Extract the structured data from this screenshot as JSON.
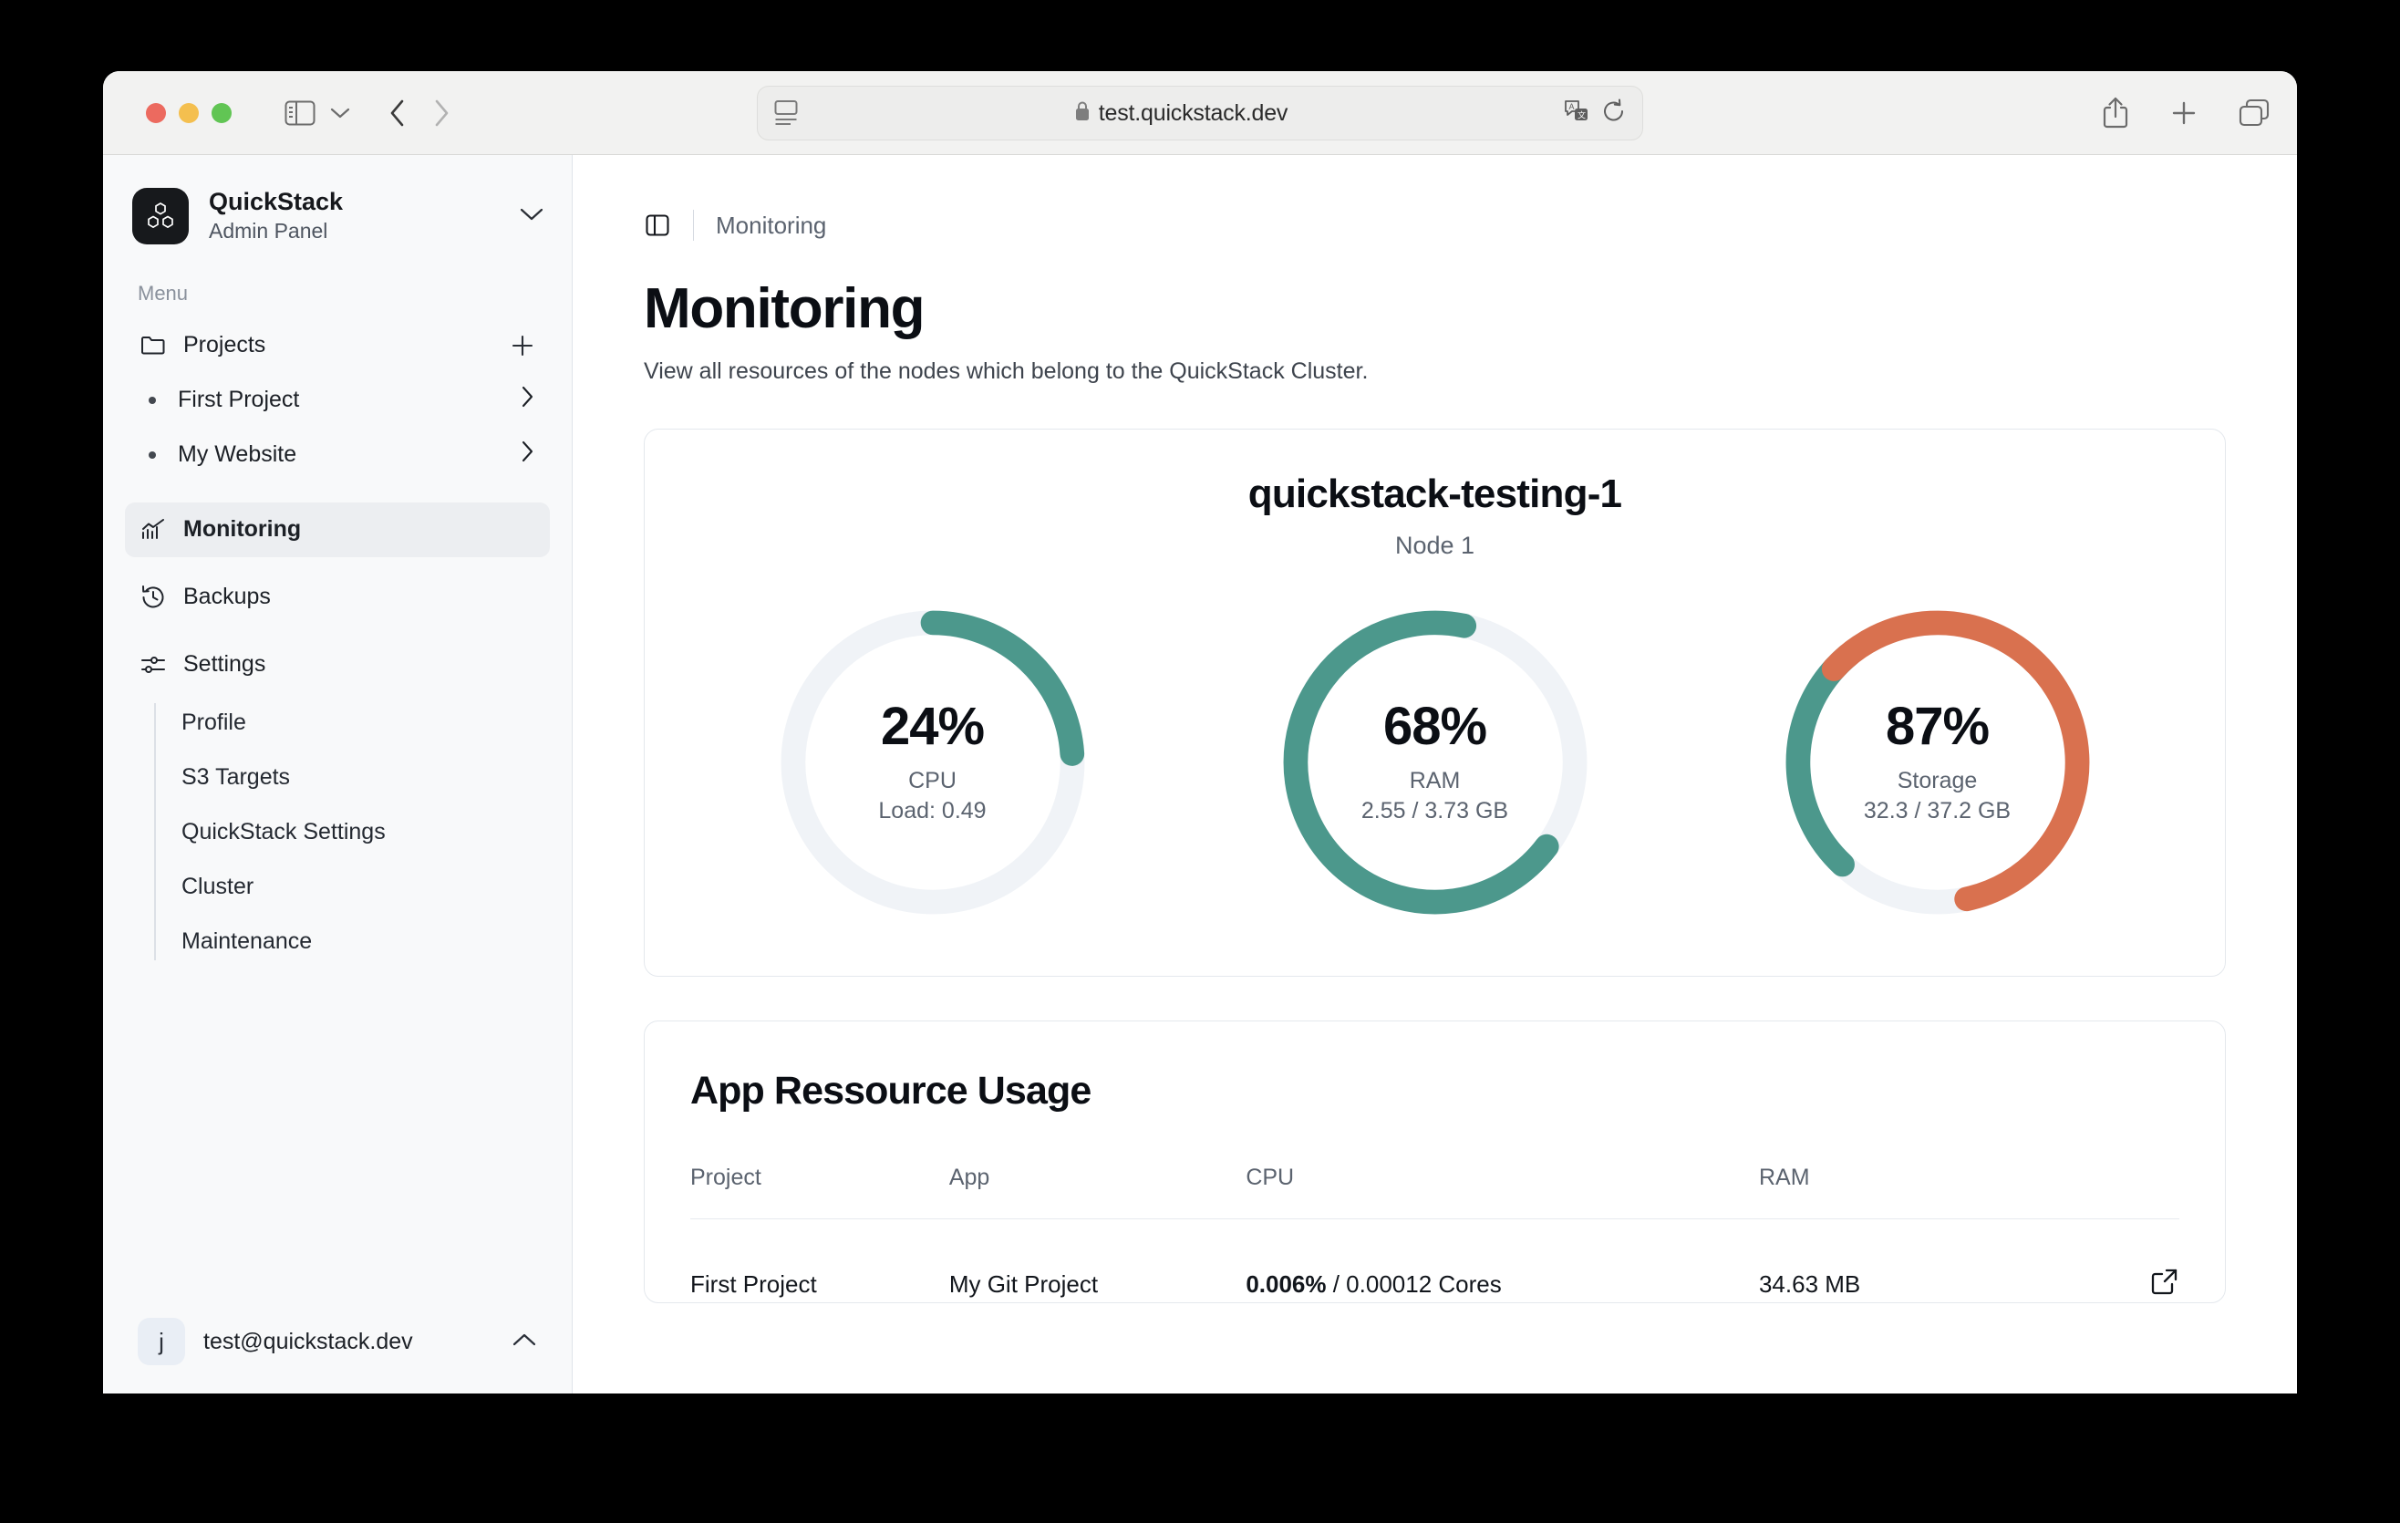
{
  "browser": {
    "url": "test.quickstack.dev",
    "icons": {
      "lock": "lock-icon",
      "reader": "reader-view-icon",
      "translate": "translate-icon",
      "reload": "reload-icon",
      "share": "share-icon",
      "new_tab": "plus-icon",
      "tab_overview": "tab-overview-icon",
      "sidebar": "sidebar-toggle-icon",
      "back": "back-arrow-icon",
      "forward": "forward-arrow-icon"
    }
  },
  "sidebar": {
    "brand": {
      "name": "QuickStack",
      "subtitle": "Admin Panel",
      "avatar_letter": ""
    },
    "menu_label": "Menu",
    "projects": {
      "label": "Projects",
      "add_label": "+",
      "children": [
        {
          "label": "First Project"
        },
        {
          "label": "My Website"
        }
      ]
    },
    "items": [
      {
        "label": "Monitoring",
        "icon": "chart-line-icon",
        "active": true
      },
      {
        "label": "Backups",
        "icon": "history-icon",
        "active": false
      },
      {
        "label": "Settings",
        "icon": "sliders-icon",
        "active": false
      }
    ],
    "settings_children": [
      {
        "label": "Profile"
      },
      {
        "label": "S3 Targets"
      },
      {
        "label": "QuickStack Settings"
      },
      {
        "label": "Cluster"
      },
      {
        "label": "Maintenance"
      }
    ],
    "user": {
      "initial": "j",
      "email": "test@quickstack.dev"
    }
  },
  "main": {
    "breadcrumb": "Monitoring",
    "title": "Monitoring",
    "subtitle": "View all resources of the nodes which belong to the QuickStack Cluster.",
    "node": {
      "name": "quickstack-testing-1",
      "subtitle": "Node 1"
    },
    "usage": {
      "title": "App Ressource Usage",
      "columns": [
        "Project",
        "App",
        "CPU",
        "RAM",
        ""
      ],
      "rows": [
        {
          "project": "First Project",
          "app": "My Git Project",
          "cpu_strong": "0.006%",
          "cpu_rest": " / 0.00012 Cores",
          "ram": "34.63 MB",
          "action": "external-link-icon"
        }
      ]
    }
  },
  "colors": {
    "teal": "#4C988C",
    "orange": "#D9714F",
    "track": "#F0F3F7",
    "sidebar_bg": "#F8F9FA",
    "accent_dark": "#17191C"
  },
  "chart_data": [
    {
      "type": "pie",
      "title": "CPU",
      "percent": 24,
      "label": "CPU",
      "detail": "Load: 0.49",
      "value_text": "24%",
      "segments": [
        {
          "name": "used",
          "value": 24,
          "color": "#4C988C"
        },
        {
          "name": "free",
          "value": 76,
          "color": "#F0F3F7"
        }
      ],
      "start_angle_deg": 0,
      "direction": "clockwise"
    },
    {
      "type": "pie",
      "title": "RAM",
      "percent": 68,
      "label": "RAM",
      "detail": "2.55 / 3.73 GB",
      "value_text": "68%",
      "segments": [
        {
          "name": "used",
          "value": 68,
          "color": "#4C988C"
        },
        {
          "name": "free",
          "value": 32,
          "color": "#F0F3F7"
        }
      ],
      "start_angle_deg": 127,
      "direction": "clockwise"
    },
    {
      "type": "pie",
      "title": "Storage",
      "percent": 87,
      "label": "Storage",
      "detail": "32.3 / 37.2 GB",
      "value_text": "87%",
      "segments": [
        {
          "name": "used-critical",
          "value": 60,
          "color": "#D9714F"
        },
        {
          "name": "used-normal",
          "value": 27,
          "color": "#4C988C"
        },
        {
          "name": "free",
          "value": 13,
          "color": "#F0F3F7"
        }
      ],
      "start_angle_deg": 223,
      "direction": "clockwise"
    }
  ]
}
